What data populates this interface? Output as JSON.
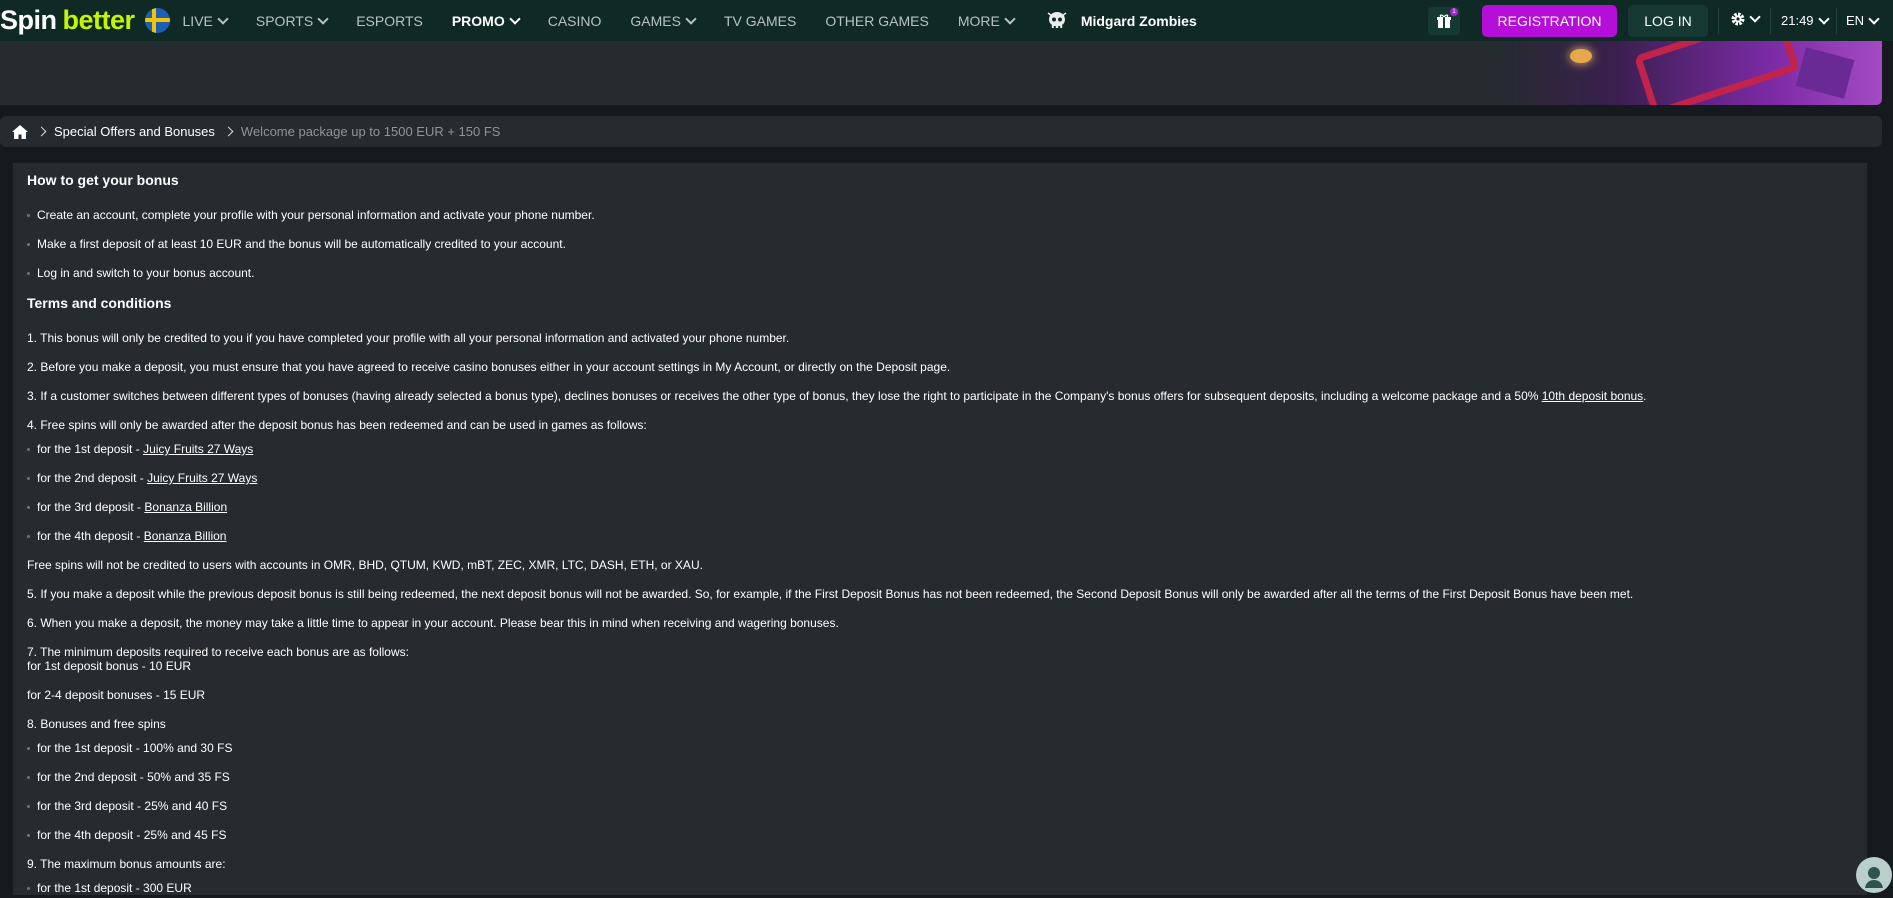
{
  "header": {
    "logo_spin": "Spin",
    "logo_better": "better",
    "nav": [
      {
        "label": "LIVE",
        "dropdown": true
      },
      {
        "label": "SPORTS",
        "dropdown": true
      },
      {
        "label": "ESPORTS",
        "dropdown": false
      },
      {
        "label": "PROMO",
        "dropdown": true,
        "active": true
      },
      {
        "label": "CASINO",
        "dropdown": false
      },
      {
        "label": "GAMES",
        "dropdown": true
      },
      {
        "label": "TV GAMES",
        "dropdown": false
      },
      {
        "label": "OTHER GAMES",
        "dropdown": false
      },
      {
        "label": "MORE",
        "dropdown": true
      }
    ],
    "featured_game": "Midgard Zombies",
    "gift_badge": "1",
    "registration": "REGISTRATION",
    "login": "LOG IN",
    "time": "21:49",
    "language": "EN",
    "colors": {
      "header_bg": "#0f2a25",
      "brand_green": "#c4f500",
      "registration_bg": "#b60ed9"
    }
  },
  "breadcrumb": {
    "items": [
      "Special Offers and Bonuses"
    ],
    "current": "Welcome package up to 1500 EUR + 150 FS"
  },
  "content": {
    "how_title": "How to get your bonus",
    "how_items": [
      "Create an account, complete your profile with your personal information and activate your phone number.",
      "Make a first deposit of at least 10 EUR and the bonus will be automatically credited to your account.",
      "Log in and switch to your bonus account."
    ],
    "terms_title": "Terms and conditions",
    "t1": "1. This bonus will only be credited to you if you have completed your profile with all your personal information and activated your phone number.",
    "t2": "2. Before you make a deposit, you must ensure that you have agreed to receive casino bonuses either in your account settings in My Account, or directly on the Deposit page.",
    "t3_pre": "3. If a customer switches between different types of bonuses (having already selected a bonus type), declines bonuses or receives the other type of bonus, they lose the right to participate in the Company's bonus offers for subsequent deposits, including a welcome package and a 50% ",
    "t3_link": "10th deposit bonus",
    "t3_post": ".",
    "t4": "4. Free spins will only be awarded after the deposit bonus has been redeemed and can be used in games as follows:",
    "t4_items": [
      {
        "pre": "for the 1st deposit - ",
        "link": "Juicy Fruits 27 Ways"
      },
      {
        "pre": "for the 2nd deposit - ",
        "link": "Juicy Fruits 27 Ways"
      },
      {
        "pre": "for the 3rd deposit - ",
        "link": "Bonanza Billion"
      },
      {
        "pre": "for the 4th deposit - ",
        "link": "Bonanza Billion"
      }
    ],
    "t4_note": "Free spins will not be credited to users with accounts in OMR, BHD, QTUM, KWD, mBT, ZEC, XMR, LTC, DASH, ETH, or XAU.",
    "t5": "5. If you make a deposit while the previous deposit bonus is still being redeemed, the next deposit bonus will not be awarded. So, for example, if the First Deposit Bonus has not been redeemed, the Second Deposit Bonus will only be awarded after all the terms of the First Deposit Bonus have been met.",
    "t6": "6. When you make a deposit, the money may take a little time to appear in your account. Please bear this in mind when receiving and wagering bonuses.",
    "t7": "7. The minimum deposits required to receive each bonus are as follows:",
    "t7_a": "for 1st deposit bonus - 10 EUR",
    "t7_b": "for 2-4 deposit bonuses - 15 EUR",
    "t8": "8. Bonuses and free spins",
    "t8_items": [
      "for the 1st deposit - 100% and 30 FS",
      "for the 2nd deposit - 50% and 35 FS",
      "for the 3rd deposit - 25% and 40 FS",
      "for the 4th deposit - 25% and 45 FS"
    ],
    "t9": "9. The maximum bonus amounts are:",
    "t9_items": [
      "for the 1st deposit - 300 EUR"
    ]
  }
}
